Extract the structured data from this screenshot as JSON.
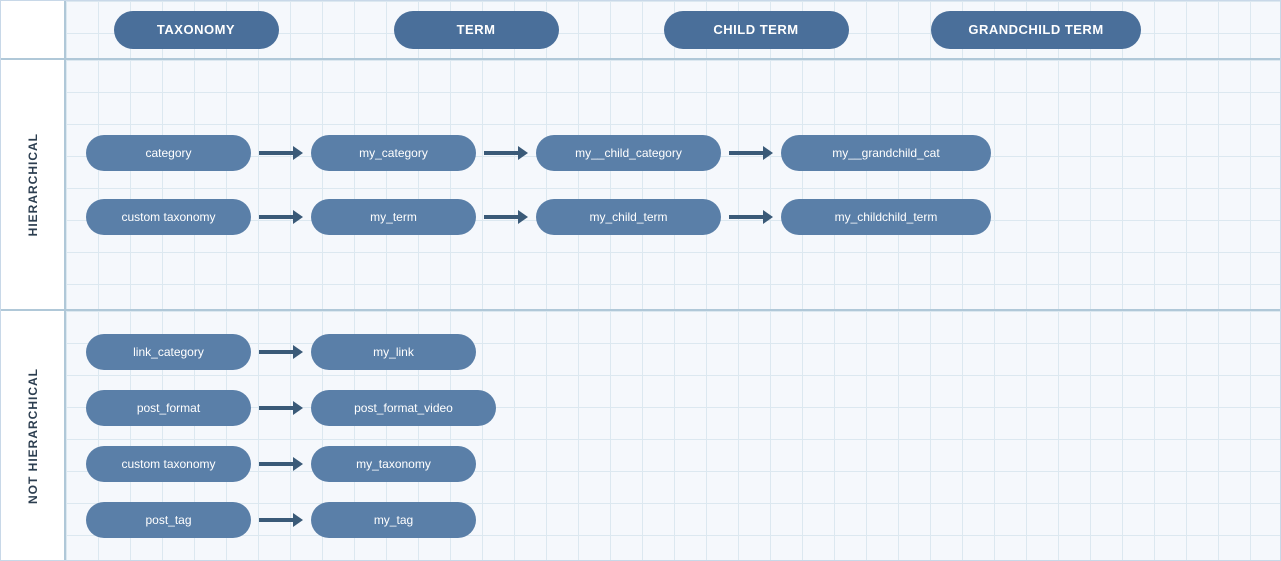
{
  "header": {
    "taxonomy_label": "TAXONOMY",
    "term_label": "TERM",
    "child_term_label": "CHILD TERM",
    "grandchild_term_label": "GRANDCHILD TERM"
  },
  "side_labels": {
    "hierarchical": "HIERARCHICAL",
    "not_hierarchical": "NOT HIERARCHICAL"
  },
  "hierarchical_rows": [
    {
      "taxonomy": "category",
      "term": "my_category",
      "child_term": "my__child_category",
      "grandchild_term": "my__grandchild_cat"
    },
    {
      "taxonomy": "custom  taxonomy",
      "term": "my_term",
      "child_term": "my_child_term",
      "grandchild_term": "my_childchild_term"
    }
  ],
  "not_hierarchical_rows": [
    {
      "taxonomy": "link_category",
      "term": "my_link"
    },
    {
      "taxonomy": "post_format",
      "term": "post_format_video"
    },
    {
      "taxonomy": "custom  taxonomy",
      "term": "my_taxonomy"
    },
    {
      "taxonomy": "post_tag",
      "term": "my_tag"
    }
  ]
}
